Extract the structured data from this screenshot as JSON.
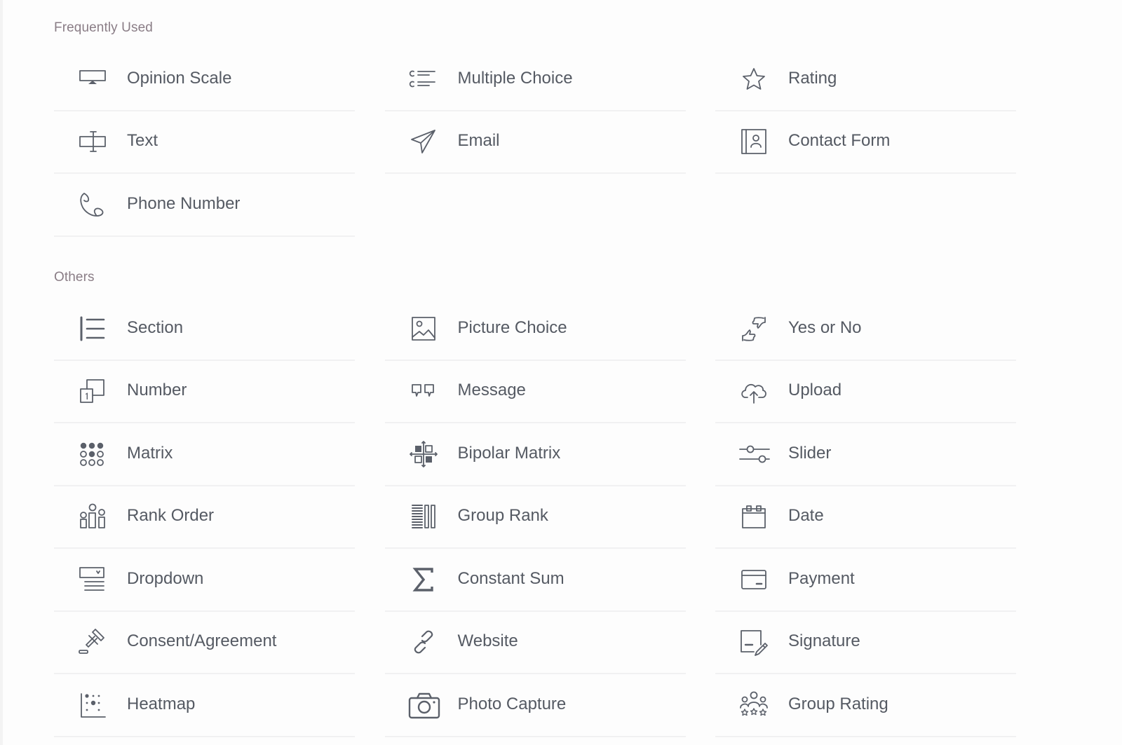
{
  "sections": [
    {
      "label": "Frequently Used",
      "items": [
        {
          "label": "Opinion Scale",
          "icon": "opinion-scale-icon"
        },
        {
          "label": "Multiple Choice",
          "icon": "multiple-choice-icon"
        },
        {
          "label": "Rating",
          "icon": "star-icon"
        },
        {
          "label": "Text",
          "icon": "text-input-icon"
        },
        {
          "label": "Email",
          "icon": "paper-plane-icon"
        },
        {
          "label": "Contact Form",
          "icon": "contact-card-icon"
        },
        {
          "label": "Phone Number",
          "icon": "phone-icon"
        }
      ]
    },
    {
      "label": "Others",
      "items": [
        {
          "label": "Section",
          "icon": "section-icon"
        },
        {
          "label": "Picture Choice",
          "icon": "picture-icon"
        },
        {
          "label": "Yes or No",
          "icon": "thumbs-up-down-icon"
        },
        {
          "label": "Number",
          "icon": "number-icon"
        },
        {
          "label": "Message",
          "icon": "quote-icon"
        },
        {
          "label": "Upload",
          "icon": "cloud-upload-icon"
        },
        {
          "label": "Matrix",
          "icon": "matrix-icon"
        },
        {
          "label": "Bipolar Matrix",
          "icon": "bipolar-matrix-icon"
        },
        {
          "label": "Slider",
          "icon": "slider-icon"
        },
        {
          "label": "Rank Order",
          "icon": "rank-order-icon"
        },
        {
          "label": "Group Rank",
          "icon": "group-rank-icon"
        },
        {
          "label": "Date",
          "icon": "calendar-icon"
        },
        {
          "label": "Dropdown",
          "icon": "dropdown-icon"
        },
        {
          "label": "Constant Sum",
          "icon": "sigma-icon"
        },
        {
          "label": "Payment",
          "icon": "credit-card-icon"
        },
        {
          "label": "Consent/Agreement",
          "icon": "gavel-icon"
        },
        {
          "label": "Website",
          "icon": "link-icon"
        },
        {
          "label": "Signature",
          "icon": "signature-icon"
        },
        {
          "label": "Heatmap",
          "icon": "heatmap-icon"
        },
        {
          "label": "Photo Capture",
          "icon": "camera-icon"
        },
        {
          "label": "Group Rating",
          "icon": "group-rating-icon"
        }
      ]
    }
  ]
}
